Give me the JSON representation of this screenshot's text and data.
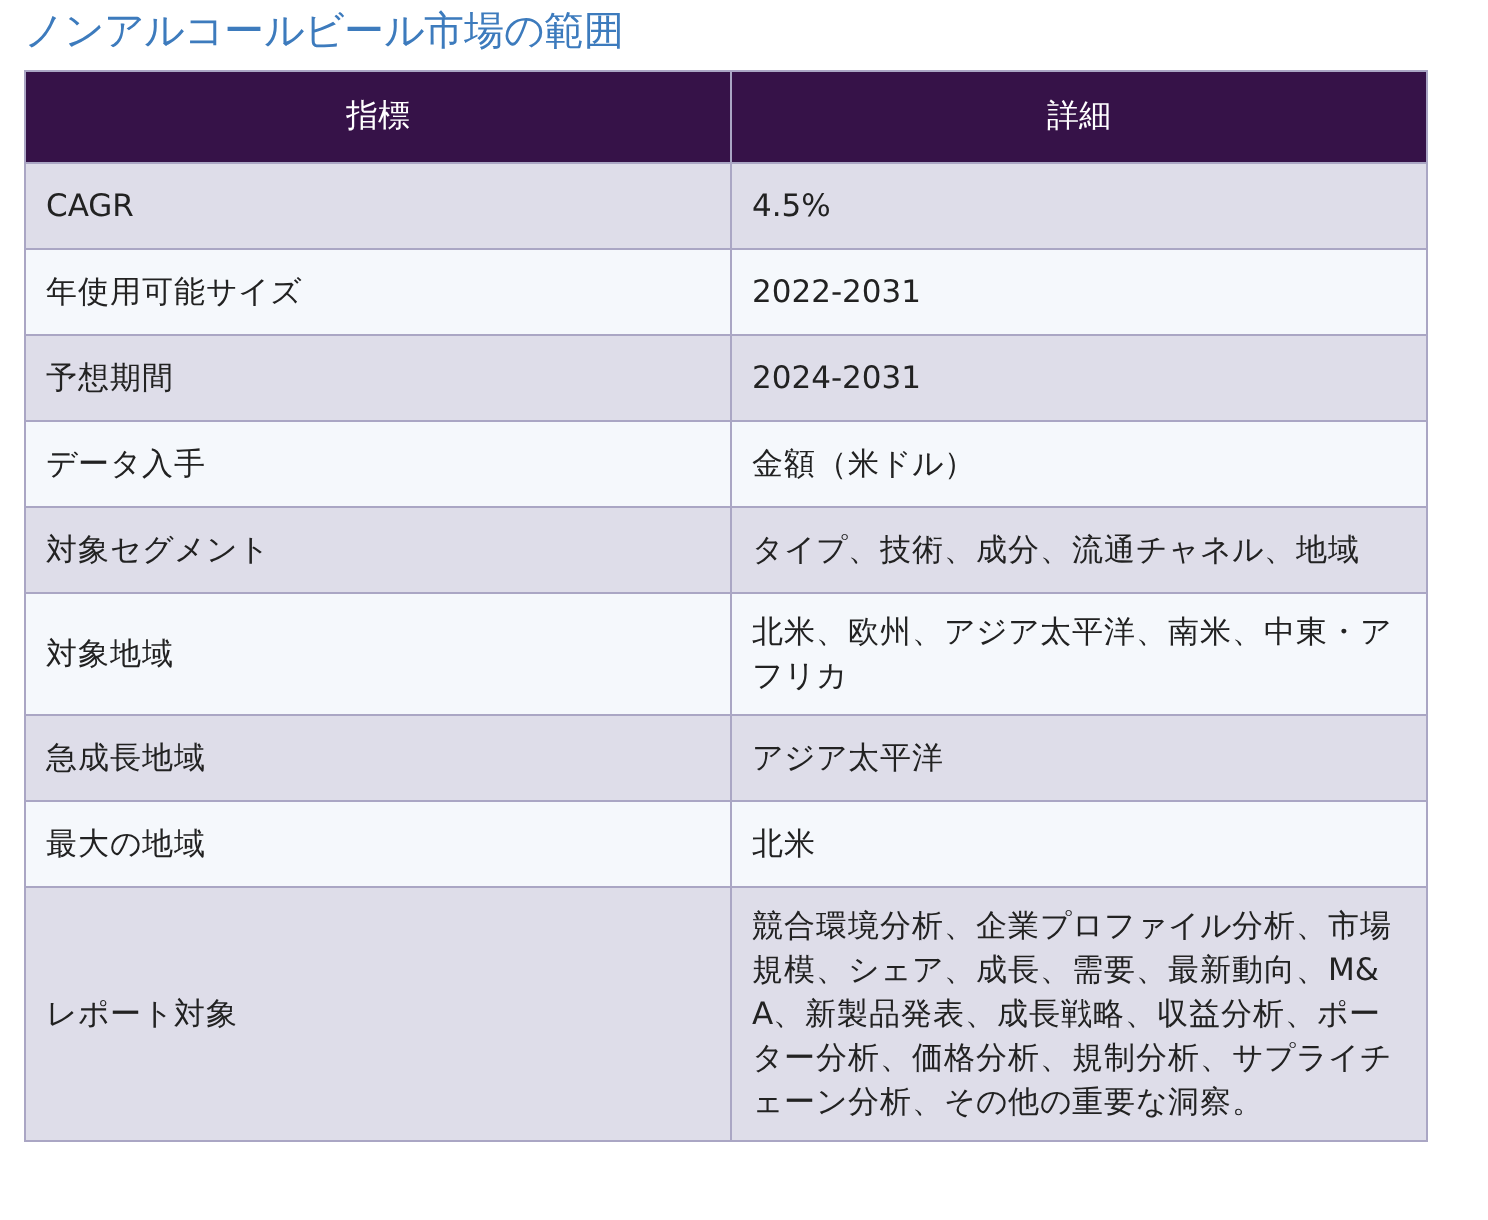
{
  "title": "ノンアルコールビール市場の範囲",
  "table": {
    "columns": [
      "指標",
      "詳細"
    ],
    "rows": [
      [
        "CAGR",
        "4.5%"
      ],
      [
        "年使用可能サイズ",
        "2022-2031"
      ],
      [
        "予想期間",
        "2024-2031"
      ],
      [
        "データ入手",
        "金額（米ドル）"
      ],
      [
        "対象セグメント",
        "タイプ、技術、成分、流通チャネル、地域"
      ],
      [
        "対象地域",
        "北米、欧州、アジア太平洋、南米、中東・アフリカ"
      ],
      [
        "急成長地域",
        "アジア太平洋"
      ],
      [
        "最大の地域",
        "北米"
      ],
      [
        "レポート対象",
        "競合環境分析、企業プロファイル分析、市場規模、シェア、成長、需要、最新動向、M&A、新製品発表、成長戦略、収益分析、ポーター分析、価格分析、規制分析、サプライチェーン分析、その他の重要な洞察。"
      ]
    ]
  }
}
